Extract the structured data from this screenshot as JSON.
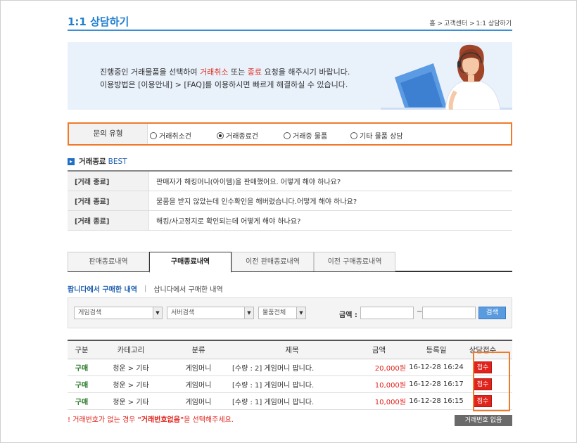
{
  "header": {
    "title": "1:1 상담하기",
    "breadcrumb": [
      "홈 >",
      "고객센터 >",
      "1:1 상담하기"
    ]
  },
  "banner": {
    "line1_pre": "진행중인 거래물품을 선택하여 ",
    "line1_red1": "거래취소",
    "line1_mid": " 또는 ",
    "line1_red2": "종료",
    "line1_post": " 요청을 해주시기 바랍니다.",
    "line2": "이용방법은 [이용안내] > [FAQ]를 이용하시면 빠르게 해결하실 수 있습니다."
  },
  "inquiry": {
    "label": "문의 유형",
    "options": [
      {
        "label": "거래취소건",
        "selected": false
      },
      {
        "label": "거래종료건",
        "selected": true
      },
      {
        "label": "거래중 물품",
        "selected": false
      },
      {
        "label": "기타 물품 상담",
        "selected": false
      }
    ]
  },
  "best": {
    "title": "거래종료",
    "accent": "BEST",
    "items": [
      {
        "category": "[거래 종료]",
        "question": "판매자가 해킹머니(아이템)을 판매했어요. 어떻게 해야 하나요?"
      },
      {
        "category": "[거래 종료]",
        "question": "물품을 받지 않았는데 인수확인을 해버렸습니다.어떻게 해야 하나요?"
      },
      {
        "category": "[거래 종료]",
        "question": "해킹/사고정지로 확인되는데 어떻게 해야 하나요?"
      }
    ]
  },
  "tabs": [
    {
      "label": "판매종료내역",
      "active": false
    },
    {
      "label": "구매종료내역",
      "active": true
    },
    {
      "label": "이전 판매종료내역",
      "active": false
    },
    {
      "label": "이전 구매종료내역",
      "active": false
    }
  ],
  "subtabs": {
    "active": "팝니다에서 구매한 내역",
    "separator": "|",
    "other": "삽니다에서 구매한 내역"
  },
  "filter": {
    "game_select": "게임검색",
    "server_select": "서버검색",
    "item_select": "물품전체",
    "price_label": "금액 :",
    "price_from": "",
    "price_to": "",
    "tilde": "~",
    "search_label": "검색"
  },
  "table": {
    "headers": [
      "구분",
      "카테고리",
      "분류",
      "제목",
      "금액",
      "등록일",
      "상담접수"
    ],
    "rows": [
      {
        "type": "구매",
        "category": "청운 > 기타",
        "kind": "게임머니",
        "title": "[수량 : 2] 게임머니 팝니다.",
        "amount": "20,000원",
        "date": "16-12-28 16:24",
        "action": "접수"
      },
      {
        "type": "구매",
        "category": "청운 > 기타",
        "kind": "게임머니",
        "title": "[수량 : 1] 게임머니 팝니다.",
        "amount": "10,000원",
        "date": "16-12-28 16:17",
        "action": "접수"
      },
      {
        "type": "구매",
        "category": "청운 > 기타",
        "kind": "게임머니",
        "title": "[수량 : 1] 게임머니 팝니다.",
        "amount": "10,000원",
        "date": "16-12-28 16:15",
        "action": "접수"
      }
    ]
  },
  "footer": {
    "notice_pre": "! 거래번호가 없는 경우 ",
    "notice_bold": "\"거래번호없음\"",
    "notice_post": "을 선택해주세요.",
    "no_deal_button": "거래번호 없음"
  },
  "colors": {
    "accent_blue": "#1f7fd0",
    "highlight_orange": "#f07a2a",
    "red": "#e0231b",
    "green": "#2c7a2c"
  }
}
